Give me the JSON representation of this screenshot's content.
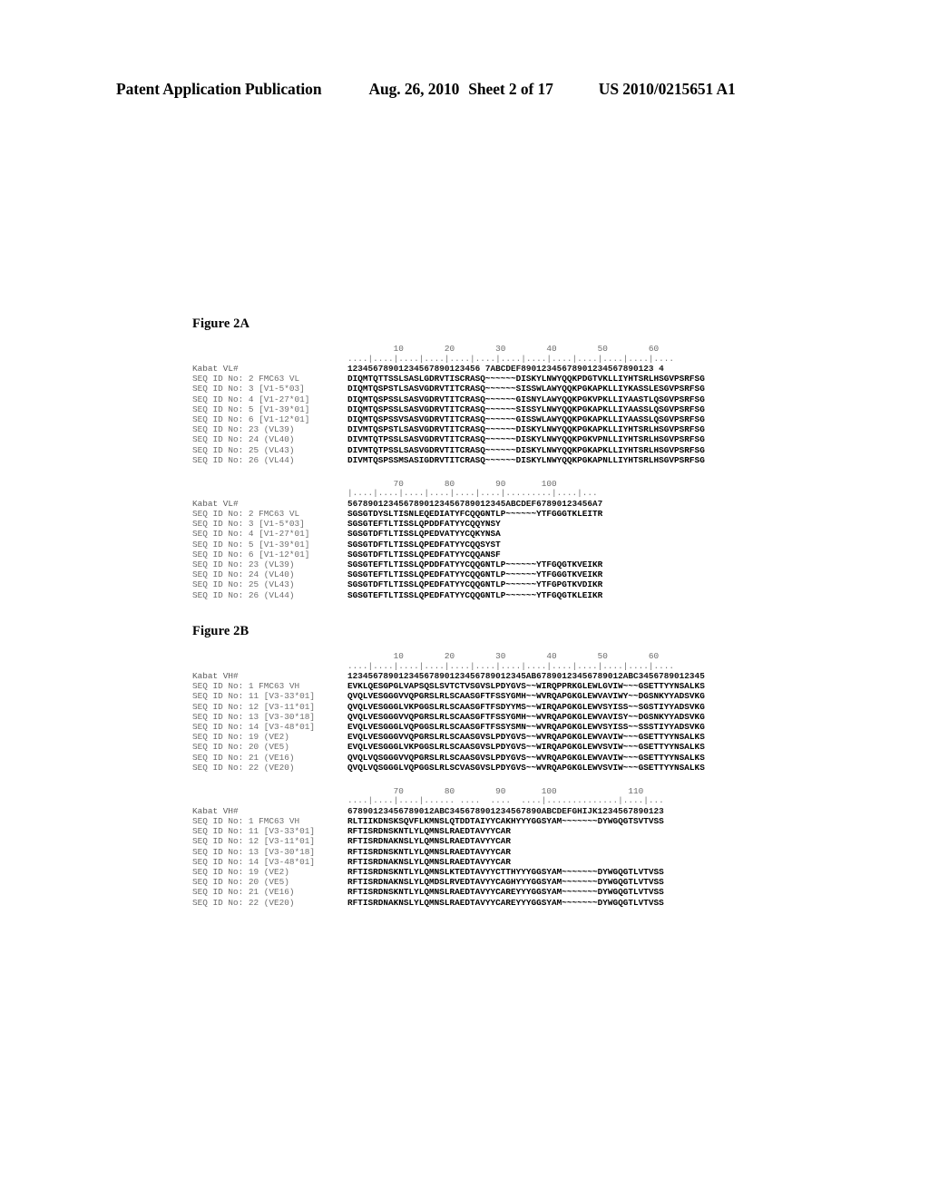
{
  "header": {
    "title": "Patent Application Publication",
    "date": "Aug. 26, 2010",
    "sheet": "Sheet 2 of 17",
    "publication_number": "US 2010/0215651 A1"
  },
  "figures": [
    {
      "caption": "Figure 2A",
      "groups": [
        {
          "ruler_numbers": "         10        20        30        40        50        60",
          "ruler_ticks": "....|....|....|....|....|....|....|....|....|....|....|....|....",
          "rows": [
            {
              "label": "Kabat VL#",
              "seq": "12345678901234567890123456 7ABCDEF89012345678901234567890123 4",
              "header": true
            },
            {
              "label": "SEQ ID No: 2 FMC63 VL",
              "seq": "DIQMTQTTSSLSASLGDRVTISCRASQ~~~~~~DISKYLNWYQQKPDGTVKLLIYHTSRLHSGVPSRFSG"
            },
            {
              "label": "SEQ ID No: 3 [V1-5*03]",
              "seq": "DIQMTQSPSTLSASVGDRVTITCRASQ~~~~~~SISSWLAWYQQKPGKAPKLLIYKASSLESGVPSRFSG"
            },
            {
              "label": "SEQ ID No: 4 [V1-27*01]",
              "seq": "DIQMTQSPSSLSASVGDRVTITCRASQ~~~~~~GISNYLAWYQQKPGKVPKLLIYAASTLQSGVPSRFSG"
            },
            {
              "label": "SEQ ID No: 5 [V1-39*01]",
              "seq": "DIQMTQSPSSLSASVGDRVTITCRASQ~~~~~~SISSYLNWYQQKPGKAPKLLIYAASSLQSGVPSRFSG"
            },
            {
              "label": "SEQ ID No: 6 [V1-12*01]",
              "seq": "DIQMTQSPSSVSASVGDRVTITCRASQ~~~~~~GISSWLAWYQQKPGKAPKLLIYAASSLQSGVPSRFSG"
            },
            {
              "label": "SEQ ID No: 23 (VL39)",
              "seq": "DIVMTQSPSTLSASVGDRVTITCRASQ~~~~~~DISKYLNWYQQKPGKAPKLLIYHTSRLHSGVPSRFSG"
            },
            {
              "label": "SEQ ID No: 24 (VL40)",
              "seq": "DIVMTQTPSSLSASVGDRVTITCRASQ~~~~~~DISKYLNWYQQKPGKVPNLLIYHTSRLHSGVPSRFSG"
            },
            {
              "label": "SEQ ID No: 25 (VL43)",
              "seq": "DIVMTQTPSSLSASVGDRVTITCRASQ~~~~~~DISKYLNWYQQKPGKAPKLLIYHTSRLHSGVPSRFSG"
            },
            {
              "label": "SEQ ID No: 26 (VL44)",
              "seq": "DIVMTQSPSSMSASIGDRVTITCRASQ~~~~~~DISKYLNWYQQKPGKAPNLLIYHTSRLHSGVPSRFSG"
            }
          ]
        },
        {
          "ruler_numbers": "         70        80        90       100",
          "ruler_ticks": "|....|....|....|....|....|....|.........|....|...",
          "rows": [
            {
              "label": "Kabat VL#",
              "seq": "5678901234567890123456789012345ABCDEF67890123456A7",
              "header": true
            },
            {
              "label": "SEQ ID No: 2 FMC63 VL",
              "seq": "SGSGTDYSLTISNLEQEDIATYFCQQGNTLP~~~~~~YTFGGGTKLEITR"
            },
            {
              "label": "SEQ ID No: 3 [V1-5*03]",
              "seq": "SGSGTEFTLTISSLQPDDFATYYCQQYNSY"
            },
            {
              "label": "SEQ ID No: 4 [V1-27*01]",
              "seq": "SGSGTDFTLTISSLQPEDVATYYCQKYNSA"
            },
            {
              "label": "SEQ ID No: 5 [V1-39*01]",
              "seq": "SGSGTDFTLTISSLQPEDFATYYCQQSYST"
            },
            {
              "label": "SEQ ID No: 6 [V1-12*01]",
              "seq": "SGSGTDFTLTISSLQPEDFATYYCQQANSF"
            },
            {
              "label": "SEQ ID No: 23 (VL39)",
              "seq": "SGSGTEFTLTISSLQPDDFATYYCQQGNTLP~~~~~~YTFGQGTKVEIKR"
            },
            {
              "label": "SEQ ID No: 24 (VL40)",
              "seq": "SGSGTEFTLTISSLQPEDFATYYCQQGNTLP~~~~~~YTFGGGTKVEIKR"
            },
            {
              "label": "SEQ ID No: 25 (VL43)",
              "seq": "SGSGTDFTLTISSLQPEDFATYYCQQGNTLP~~~~~~YTFGPGTKVDIKR"
            },
            {
              "label": "SEQ ID No: 26 (VL44)",
              "seq": "SGSGTEFTLTISSLQPEDFATYYCQQGNTLP~~~~~~YTFGQGTKLEIKR"
            }
          ]
        }
      ]
    },
    {
      "caption": "Figure 2B",
      "groups": [
        {
          "ruler_numbers": "         10        20        30        40        50        60",
          "ruler_ticks": "....|....|....|....|....|....|....|....|....|....|....|....|....",
          "rows": [
            {
              "label": "Kabat VH#",
              "seq": "12345678901234567890123456789012345AB67890123456789012ABC3456789012345",
              "header": true
            },
            {
              "label": "SEQ ID No: 1 FMC63 VH",
              "seq": "EVKLQESGPGLVAPSQSLSVTCTVSGVSLPDYGVS~~WIRQPPRKGLEWLGVIW~~~GSETTYYNSALKS"
            },
            {
              "label": "SEQ ID No: 11 [V3-33*01]",
              "seq": "QVQLVESGGGVVQPGRSLRLSCAASGFTFSSYGMH~~WVRQAPGKGLEWVAVIWY~~DGSNKYYADSVKG"
            },
            {
              "label": "SEQ ID No: 12 [V3-11*01]",
              "seq": "QVQLVESGGGLVKPGGSLRLSCAASGFTFSDYYMS~~WIRQAPGKGLEWVSYISS~~SGSTIYYADSVKG"
            },
            {
              "label": "SEQ ID No: 13 [V3-30*18]",
              "seq": "QVQLVESGGGVVQPGRSLRLSCAASGFTFSSYGMH~~WVRQAPGKGLEWVAVISY~~DGSNKYYADSVKG"
            },
            {
              "label": "SEQ ID No: 14 [V3-48*01]",
              "seq": "EVQLVESGGGLVQPGGSLRLSCAASGFTFSSYSMN~~WVRQAPGKGLEWVSYISS~~SSSTIYYADSVKG"
            },
            {
              "label": "SEQ ID No: 19 (VE2)",
              "seq": "EVQLVESGGGVVQPGRSLRLSCAASGVSLPDYGVS~~WVRQAPGKGLEWVAVIW~~~GSETTYYNSALKS"
            },
            {
              "label": "SEQ ID No: 20 (VE5)",
              "seq": "EVQLVESGGGLVKPGGSLRLSCAASGVSLPDYGVS~~WIRQAPGKGLEWVSVIW~~~GSETTYYNSALKS"
            },
            {
              "label": "SEQ ID No: 21 (VE16)",
              "seq": "QVQLVQSGGGVVQPGRSLRLSCAASGVSLPDYGVS~~WVRQAPGKGLEWVAVIW~~~GSETTYYNSALKS"
            },
            {
              "label": "SEQ ID No: 22 (VE20)",
              "seq": "QVQLVQSGGGLVQPGGSLRLSCVASGVSLPDYGVS~~WVRQAPGKGLEWVSVIW~~~GSETTYYNSALKS"
            }
          ]
        },
        {
          "ruler_numbers": "         70        80        90       100              110",
          "ruler_ticks": "....|....|....|...... ....  ....  ....|..............|....|...",
          "rows": [
            {
              "label": "Kabat VH#",
              "seq": "67890123456789012ABC345678901234567890ABCDEFGHIJK1234567890123",
              "header": true
            },
            {
              "label": "SEQ ID No: 1 FMC63 VH",
              "seq": "RLTIIKDNSKSQVFLKMNSLQTDDTAIYYCAKHYYYGGSYAM~~~~~~~DYWGQGTSVTVSS"
            },
            {
              "label": "SEQ ID No: 11 [V3-33*01]",
              "seq": "RFTISRDNSKNTLYLQMNSLRAEDTAVYYCAR"
            },
            {
              "label": "SEQ ID No: 12 [V3-11*01]",
              "seq": "RFTISRDNAKNSLYLQMNSLRAEDTAVYYCAR"
            },
            {
              "label": "SEQ ID No: 13 [V3-30*18]",
              "seq": "RFTISRDNSKNTLYLQMNSLRAEDTAVYYCAR"
            },
            {
              "label": "SEQ ID No: 14 [V3-48*01]",
              "seq": "RFTISRDNAKNSLYLQMNSLRAEDTAVYYCAR"
            },
            {
              "label": "SEQ ID No: 19 (VE2)",
              "seq": "RFTISRDNSKNTLYLQMNSLKTEDTAVYYCTTHYYYGGSYAM~~~~~~~DYWGQGTLVTVSS"
            },
            {
              "label": "SEQ ID No: 20 (VE5)",
              "seq": "RFTISRDNAKNSLYLQMDSLRVEDTAVYYCAGHYYYGGSYAM~~~~~~~DYWGQGTLVTVSS"
            },
            {
              "label": "SEQ ID No: 21 (VE16)",
              "seq": "RFTISRDNSKNTLYLQMNSLRAEDTAVYYCAREYYYGGSYAM~~~~~~~DYWGQGTLVTVSS"
            },
            {
              "label": "SEQ ID No: 22 (VE20)",
              "seq": "RFTISRDNAKNSLYLQMNSLRAEDTAVYYCAREYYYGGSYAM~~~~~~~DYWGQGTLVTVSS"
            }
          ]
        }
      ]
    }
  ]
}
